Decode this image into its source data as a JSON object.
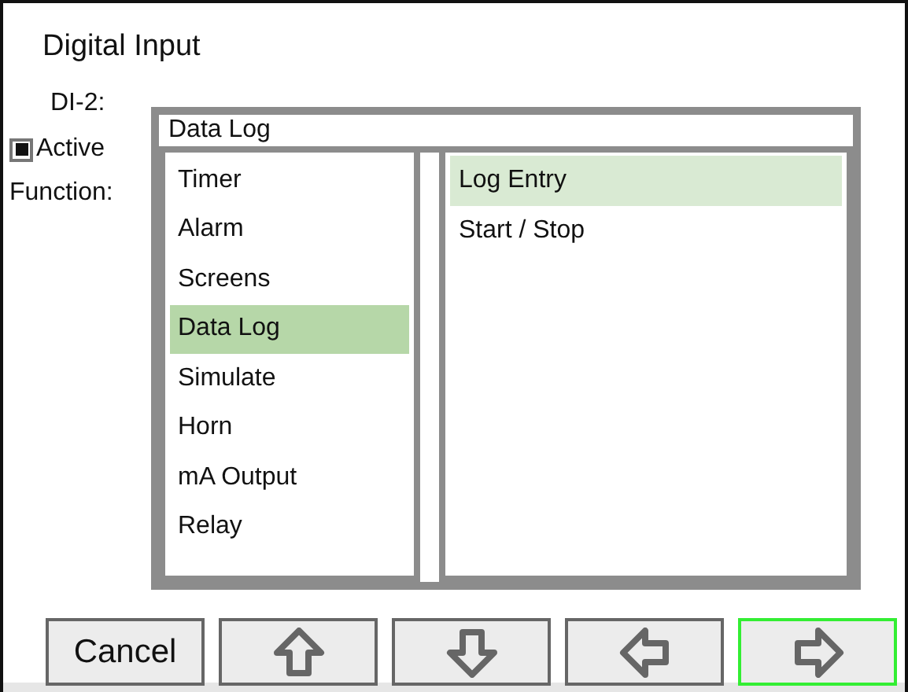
{
  "window": {
    "title": "Digital Input"
  },
  "form": {
    "input_label": "DI-2:",
    "active": {
      "label": "Active",
      "checked": true
    },
    "function_label": "Function:"
  },
  "popup": {
    "value": "Data Log",
    "categories": [
      {
        "label": "Timer",
        "selected": false
      },
      {
        "label": "Alarm",
        "selected": false
      },
      {
        "label": "Screens",
        "selected": false
      },
      {
        "label": "Data Log",
        "selected": true
      },
      {
        "label": "Simulate",
        "selected": false
      },
      {
        "label": "Horn",
        "selected": false
      },
      {
        "label": "mA Output",
        "selected": false
      },
      {
        "label": "Relay",
        "selected": false
      }
    ],
    "options": [
      {
        "label": "Log Entry",
        "selected": true
      },
      {
        "label": "Start / Stop",
        "selected": false
      }
    ]
  },
  "buttons": [
    {
      "kind": "text",
      "label": "Cancel",
      "focused": false
    },
    {
      "kind": "up",
      "focused": false
    },
    {
      "kind": "down",
      "focused": false
    },
    {
      "kind": "left",
      "focused": false
    },
    {
      "kind": "right",
      "focused": true
    }
  ]
}
